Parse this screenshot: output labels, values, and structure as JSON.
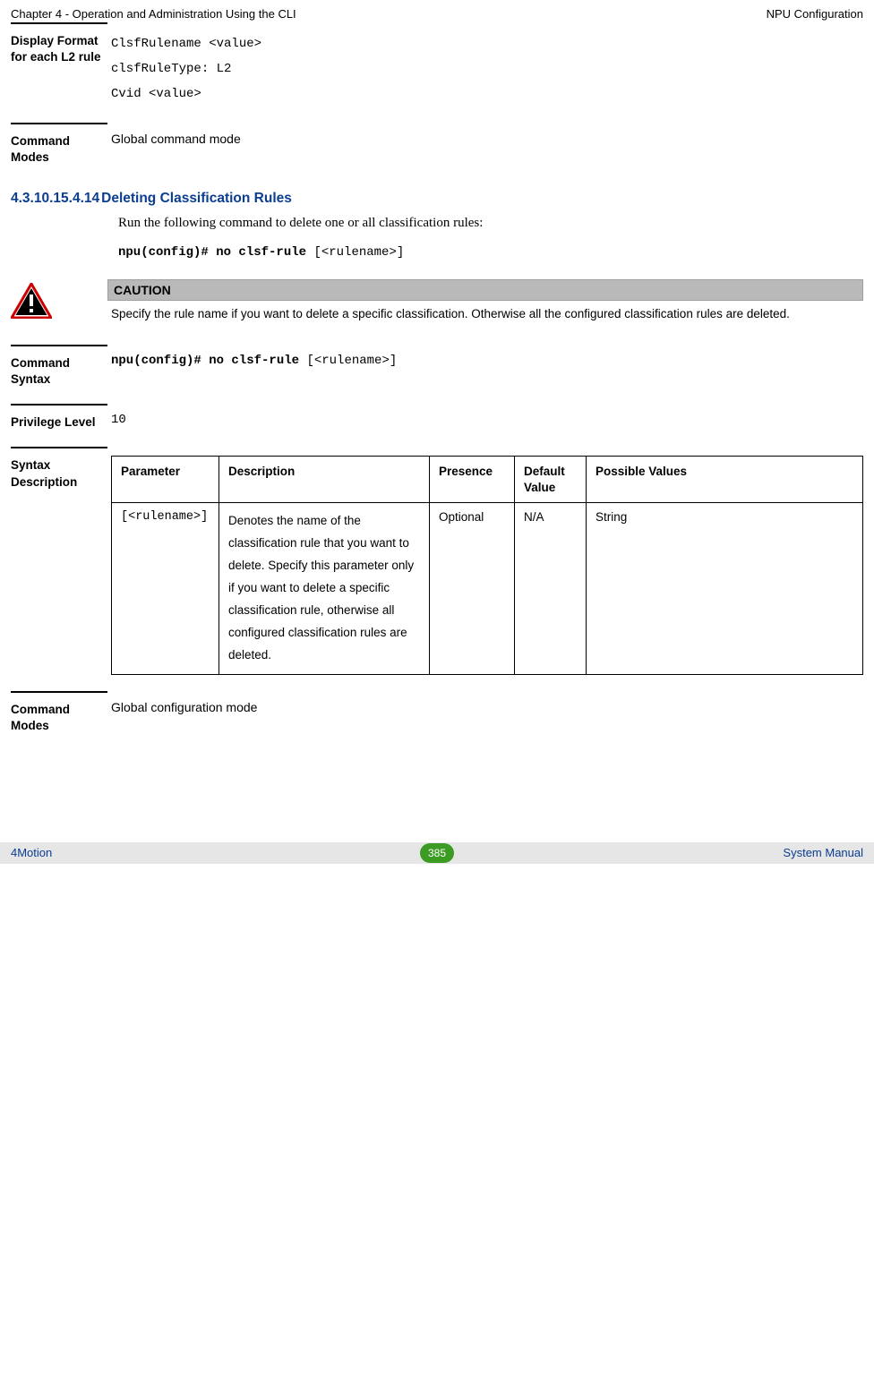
{
  "header": {
    "left": "Chapter 4 - Operation and Administration Using the CLI",
    "right": "NPU Configuration"
  },
  "display_format": {
    "label": "Display Format for each L2 rule",
    "lines": [
      "ClsfRulename <value>",
      "clsfRuleType: L2",
      "Cvid <value>"
    ]
  },
  "command_modes_1": {
    "label": "Command Modes",
    "value": "Global command mode"
  },
  "section": {
    "number": "4.3.10.15.4.14",
    "title": "Deleting Classification Rules",
    "intro": "Run the following command to delete one or all classification rules:",
    "cmd_bold": "npu(config)# no clsf-rule",
    "cmd_rest": " [<rulename>]"
  },
  "caution": {
    "label": "CAUTION",
    "text": "Specify the rule name  if you want to delete a specific classification. Otherwise all the configured classification rules are deleted."
  },
  "command_syntax": {
    "label": "Command Syntax",
    "bold": "npu(config)# no clsf-rule",
    "rest": " [<rulename>]"
  },
  "privilege_level": {
    "label": "Privilege Level",
    "value": "10"
  },
  "syntax_description": {
    "label": "Syntax Description",
    "headers": [
      "Parameter",
      "Description",
      "Presence",
      "Default Value",
      "Possible Values"
    ],
    "row": {
      "parameter": "[<rulename>]",
      "description": "Denotes the name of the classification rule that you want to delete. Specify this parameter only if you want to delete a specific classification rule, otherwise all configured classification rules are deleted.",
      "presence": "Optional",
      "default": "N/A",
      "possible": "String"
    }
  },
  "command_modes_2": {
    "label": "Command Modes",
    "value": "Global configuration mode"
  },
  "footer": {
    "left": "4Motion",
    "page": "385",
    "right": "System Manual"
  }
}
